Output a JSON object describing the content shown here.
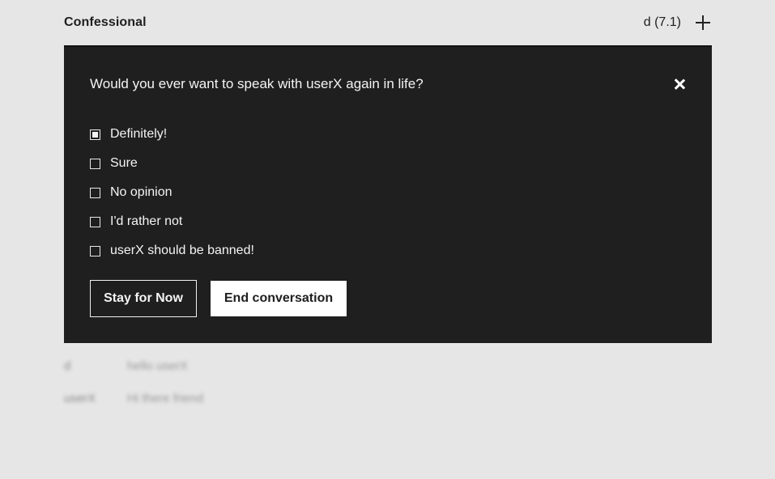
{
  "header": {
    "title": "Confessional",
    "session": "d (7.1)",
    "add_icon": "plus-icon"
  },
  "background_rows": [
    {
      "user": "d",
      "text": "hello userX"
    },
    {
      "user": "userX",
      "text": "Hi there friend"
    }
  ],
  "modal": {
    "question": "Would you ever want to speak with userX again in life?",
    "close_icon": "close-icon",
    "options": [
      {
        "label": "Definitely!",
        "checked": true
      },
      {
        "label": "Sure",
        "checked": false
      },
      {
        "label": "No opinion",
        "checked": false
      },
      {
        "label": "I'd rather not",
        "checked": false
      },
      {
        "label": "userX should be banned!",
        "checked": false
      }
    ],
    "stay_label": "Stay for Now",
    "end_label": "End conversation"
  },
  "colors": {
    "page_bg": "#e6e6e6",
    "modal_bg": "#1f1f1f",
    "button_primary_bg": "#ffffff"
  }
}
